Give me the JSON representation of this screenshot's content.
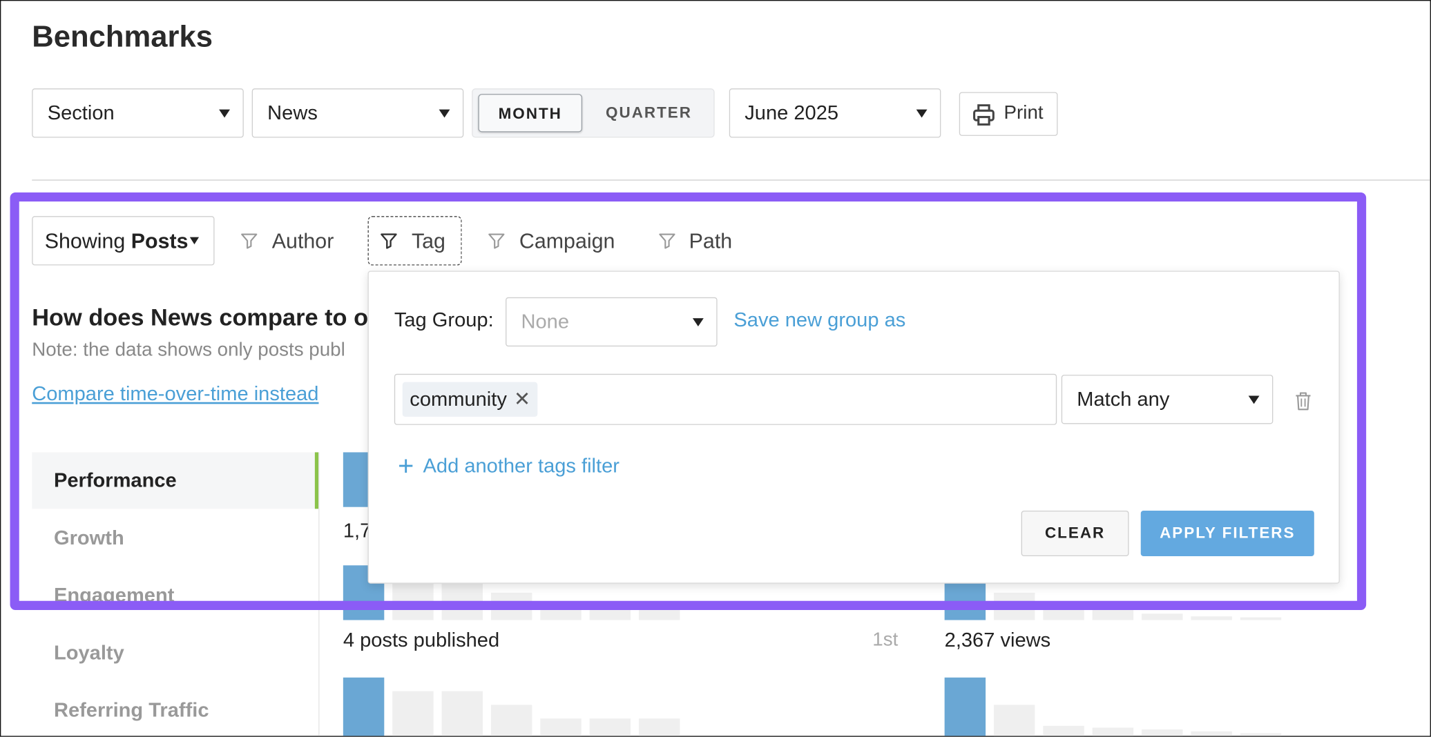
{
  "header": {
    "title": "Benchmarks"
  },
  "toolbar": {
    "type_select": "Section",
    "section_select": "News",
    "period_toggle": {
      "month": "MONTH",
      "quarter": "QUARTER",
      "active": "MONTH"
    },
    "date_select": "June 2025",
    "print_label": "Print"
  },
  "filters": {
    "showing_prefix": "Showing",
    "showing_value": "Posts",
    "author": "Author",
    "tag": "Tag",
    "campaign": "Campaign",
    "path": "Path"
  },
  "main": {
    "question": "How does News compare to ot",
    "note": "Note: the data shows only posts publ",
    "compare_link": "Compare time-over-time instead"
  },
  "sidenav": {
    "items": [
      "Performance",
      "Growth",
      "Engagement",
      "Loyalty",
      "Referring Traffic"
    ],
    "active": "Performance"
  },
  "metrics": {
    "row1_left_partial": "1,7",
    "row2_left_label": "4 posts published",
    "row2_left_rank": "1st",
    "row2_right_label": "2,367 views"
  },
  "tag_popup": {
    "tag_group_label": "Tag Group:",
    "tag_group_placeholder": "None",
    "save_link": "Save new group as",
    "chips": [
      "community"
    ],
    "chip_remove_glyph": "✕",
    "match_select": "Match any",
    "add_filter": "Add another tags filter",
    "clear_button": "CLEAR",
    "apply_button": "APPLY FILTERS"
  },
  "colors": {
    "accent_blue": "#4a9fd6",
    "bar_blue": "#6aa7d4",
    "highlight_purple": "#8b5cf6",
    "active_marker_green": "#8bc34a"
  }
}
